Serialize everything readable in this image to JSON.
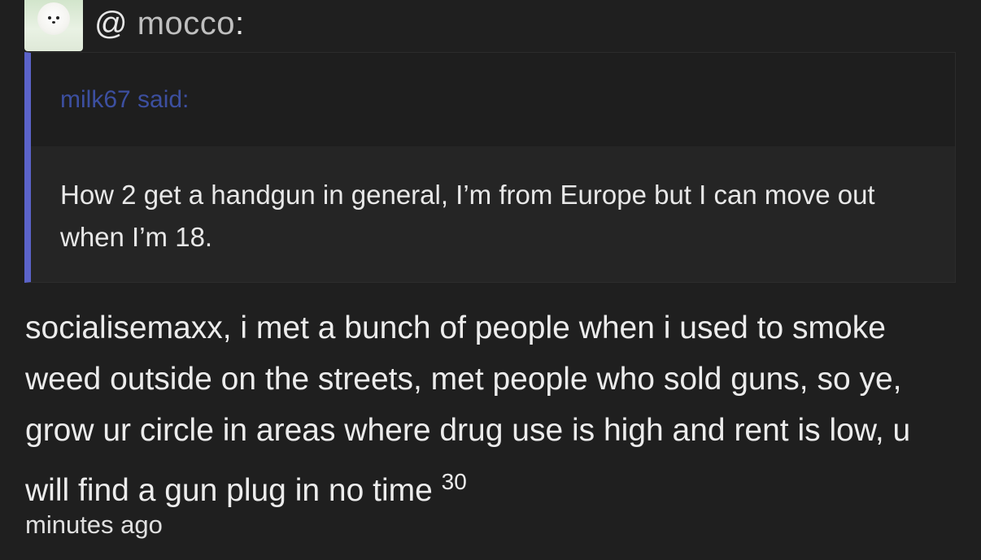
{
  "post": {
    "mention_prefix": "@",
    "mention_user": "mocco",
    "mention_suffix": ":",
    "quote": {
      "author_label": "milk67 said:",
      "text": "How 2 get a handgun in general, I’m from Europe but I can move out when I’m 18."
    },
    "reply_text": "socialisemaxx, i met a bunch of people when i used to smoke weed outside on the streets, met people who sold guns, so ye, grow ur circle in areas where drug use is high and rent is low, u will find a gun plug in no time",
    "time_number": "30",
    "time_unit": "minutes ago"
  },
  "colors": {
    "background": "#1f1f1f",
    "quote_bar": "#5b63c9",
    "quote_author": "#3c4fa0"
  },
  "icons": {
    "avatar": "white-pomeranian-avatar"
  }
}
